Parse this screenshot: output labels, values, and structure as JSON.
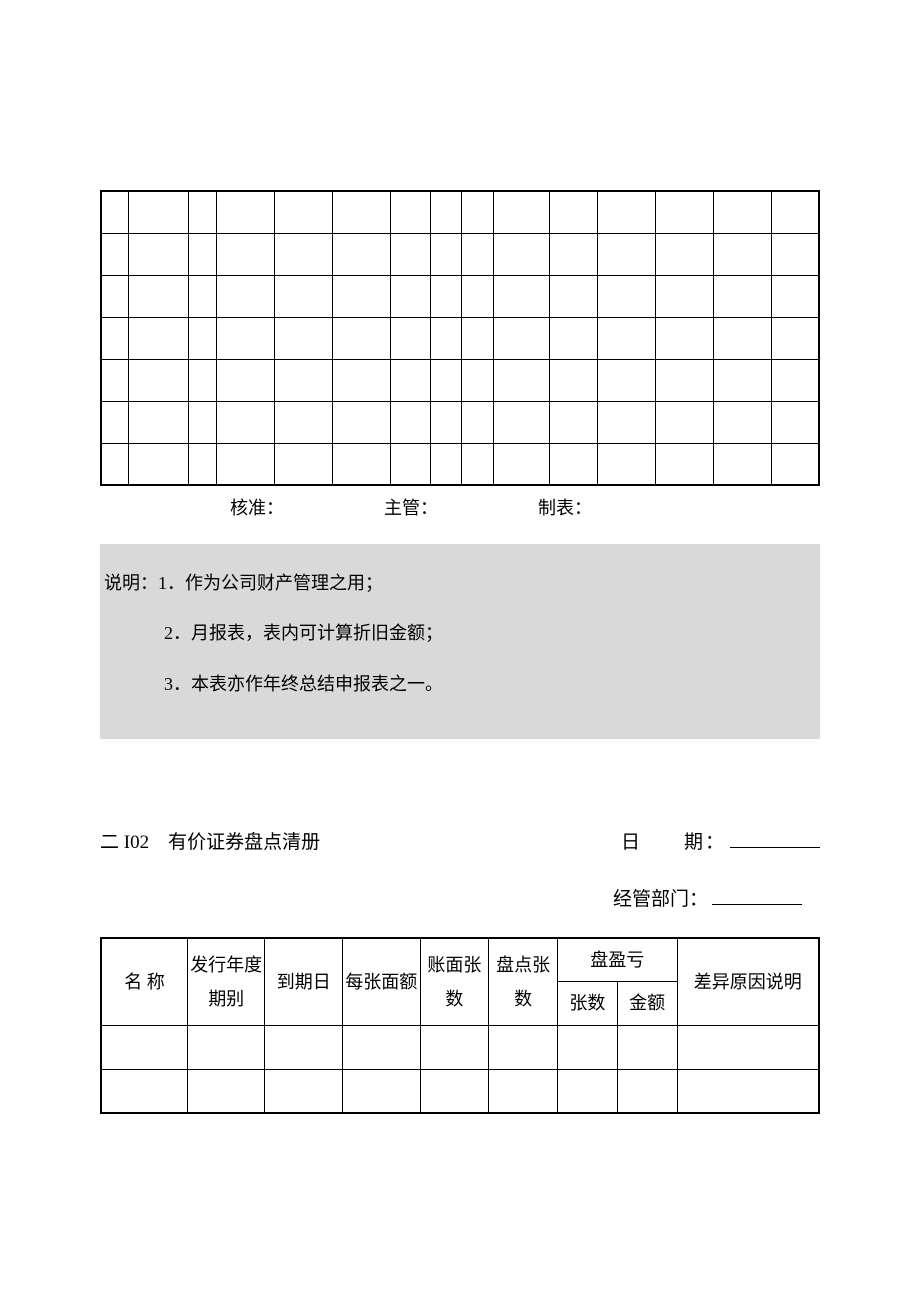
{
  "table1": {
    "rows": 7,
    "cols": 15
  },
  "signatures": {
    "approve": "核准：",
    "supervisor": "主管：",
    "preparer": "制表："
  },
  "notes": {
    "line1": "说明：1．作为公司财产管理之用；",
    "line2": "2．月报表，表内可计算折旧金额；",
    "line3": "3．本表亦作年终总结申报表之一。"
  },
  "section2": {
    "title": "二 I02　有价证券盘点清册",
    "date_label": "日　　期：",
    "dept_label": "经管部门："
  },
  "table2": {
    "headers": {
      "name": "名 称",
      "issue_year": "发行年度期别",
      "due_date": "到期日",
      "face_value": "每张面额",
      "book_sheets": "账面张数",
      "count_sheets": "盘点张数",
      "profit_loss": "盘盈亏",
      "pl_sheets": "张数",
      "pl_amount": "金额",
      "reason": "差异原因说明"
    },
    "data_rows": 2
  }
}
